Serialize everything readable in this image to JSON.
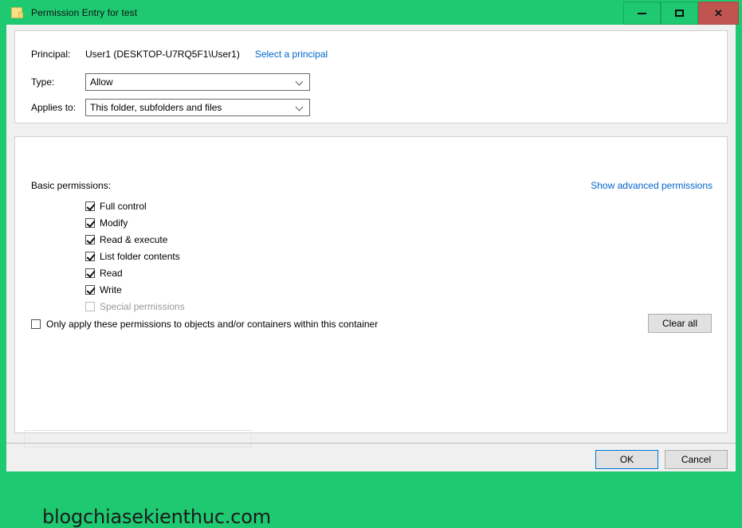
{
  "window": {
    "title": "Permission Entry for test",
    "icon": "folder-icon",
    "accent_green": "#1ec971",
    "close_red": "#bf5450",
    "controls": {
      "minimize": "minimize-icon",
      "maximize": "maximize-icon",
      "close": "✕"
    }
  },
  "principal_section": {
    "principal_label": "Principal:",
    "principal_value": "User1 (DESKTOP-U7RQ5F1\\User1)",
    "select_principal_link": "Select a principal",
    "type_label": "Type:",
    "type_value": "Allow",
    "applies_to_label": "Applies to:",
    "applies_to_value": "This folder, subfolders and files"
  },
  "permissions_section": {
    "basic_permissions_label": "Basic permissions:",
    "show_advanced_link": "Show advanced permissions",
    "items": [
      {
        "label": "Full control",
        "checked": true,
        "disabled": false
      },
      {
        "label": "Modify",
        "checked": true,
        "disabled": false
      },
      {
        "label": "Read & execute",
        "checked": true,
        "disabled": false
      },
      {
        "label": "List folder contents",
        "checked": true,
        "disabled": false
      },
      {
        "label": "Read",
        "checked": true,
        "disabled": false
      },
      {
        "label": "Write",
        "checked": true,
        "disabled": false
      },
      {
        "label": "Special permissions",
        "checked": false,
        "disabled": true
      }
    ],
    "only_apply_label": "Only apply these permissions to objects and/or containers within this container",
    "only_apply_checked": false,
    "clear_all_label": "Clear all"
  },
  "watermark": "blogchiasekienthuc.com",
  "footer": {
    "ok_label": "OK",
    "cancel_label": "Cancel"
  }
}
